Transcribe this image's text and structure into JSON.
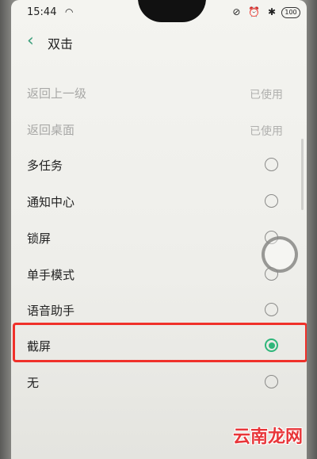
{
  "status_bar": {
    "time": "15:44",
    "battery": "100",
    "wifi_icon": "wifi-icon",
    "right_icons": "⊘ ⏰ ✱"
  },
  "header": {
    "title": "双击"
  },
  "options": [
    {
      "label": "返回上一级",
      "state": "已使用",
      "disabled": true
    },
    {
      "label": "返回桌面",
      "state": "已使用",
      "disabled": true
    },
    {
      "label": "多任务",
      "selected": false
    },
    {
      "label": "通知中心",
      "selected": false
    },
    {
      "label": "锁屏",
      "selected": false
    },
    {
      "label": "单手模式",
      "selected": false
    },
    {
      "label": "语音助手",
      "selected": false
    },
    {
      "label": "截屏",
      "selected": true
    },
    {
      "label": "无",
      "selected": false
    }
  ],
  "colors": {
    "accent": "#2fb67a",
    "back_arrow": "#3a9e7a",
    "highlight": "#f0312a"
  },
  "watermark": "云南龙网"
}
